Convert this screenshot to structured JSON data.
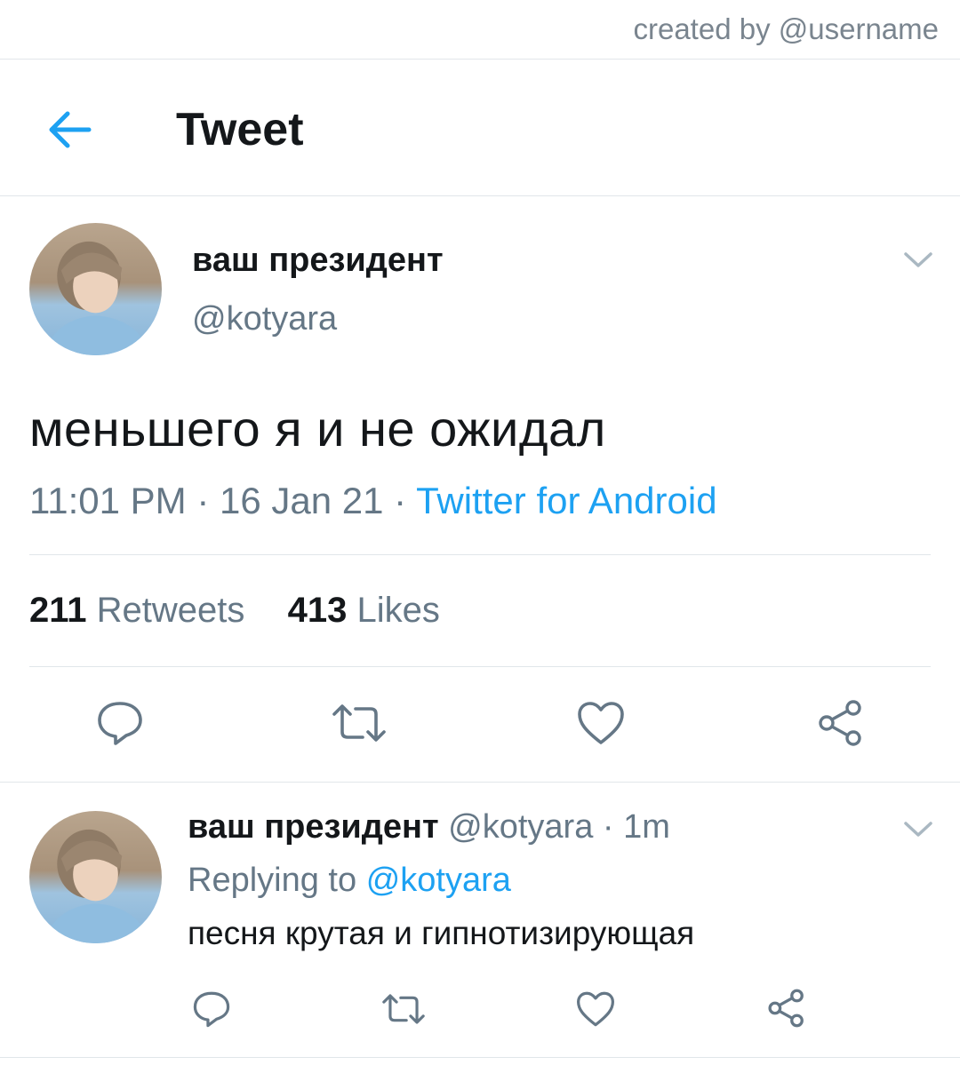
{
  "watermark": "created by @username",
  "header": {
    "title": "Tweet",
    "back_icon": "arrow-left-icon"
  },
  "colors": {
    "accent": "#1da1f2",
    "muted": "#657786",
    "text": "#14171a",
    "divider": "#e1e6ea"
  },
  "tweet": {
    "display_name": "ваш президент",
    "handle": "@kotyara",
    "text": "меньшего я и не ожидал",
    "time": "11:01 PM",
    "date": "16 Jan 21",
    "source": "Twitter for Android",
    "sep": "·",
    "retweets_count": "211",
    "retweets_label": "Retweets",
    "likes_count": "413",
    "likes_label": "Likes",
    "actions": [
      "reply-icon",
      "retweet-icon",
      "like-icon",
      "share-icon"
    ]
  },
  "reply": {
    "display_name": "ваш президент",
    "handle": "@kotyara",
    "age": "· 1m",
    "replying_prefix": "Replying to",
    "replying_handle": "@kotyara",
    "text": "песня крутая и гипнотизирующая",
    "actions": [
      "reply-icon",
      "retweet-icon",
      "like-icon",
      "share-icon"
    ]
  }
}
